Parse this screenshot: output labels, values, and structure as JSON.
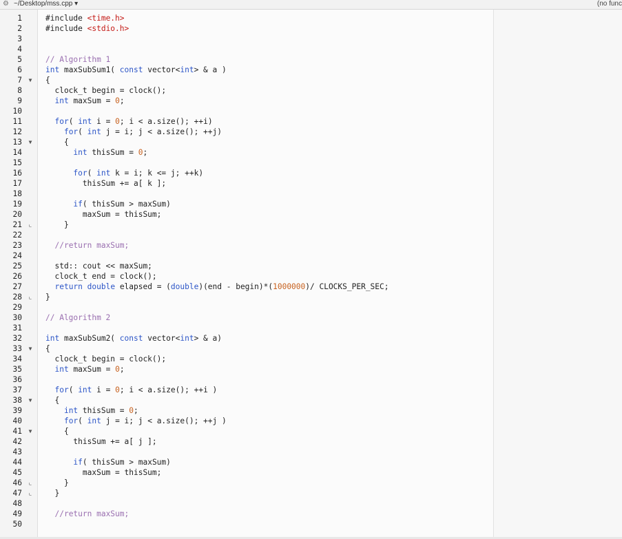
{
  "titlebar": {
    "path": "~/Desktop/mss.cpp",
    "function_menu": "(no func",
    "gear_icon": "gear-icon"
  },
  "lines": [
    {
      "n": "1",
      "fold": "",
      "tokens": [
        [
          "pp",
          "#include "
        ],
        [
          "str",
          "<time.h>"
        ]
      ]
    },
    {
      "n": "2",
      "fold": "",
      "tokens": [
        [
          "pp",
          "#include "
        ],
        [
          "str",
          "<stdio.h>"
        ]
      ]
    },
    {
      "n": "3",
      "fold": "",
      "tokens": []
    },
    {
      "n": "4",
      "fold": "",
      "tokens": []
    },
    {
      "n": "5",
      "fold": "",
      "tokens": [
        [
          "cm",
          "// Algorithm 1"
        ]
      ]
    },
    {
      "n": "6",
      "fold": "",
      "tokens": [
        [
          "kw",
          "int"
        ],
        [
          "t",
          " maxSubSum1( "
        ],
        [
          "kw",
          "const"
        ],
        [
          "t",
          " vector<"
        ],
        [
          "kw",
          "int"
        ],
        [
          "t",
          "> & a )"
        ]
      ]
    },
    {
      "n": "7",
      "fold": "open",
      "tokens": [
        [
          "t",
          "{"
        ]
      ]
    },
    {
      "n": "8",
      "fold": "",
      "tokens": [
        [
          "t",
          "  clock_t begin = clock();"
        ]
      ]
    },
    {
      "n": "9",
      "fold": "",
      "tokens": [
        [
          "t",
          "  "
        ],
        [
          "kw",
          "int"
        ],
        [
          "t",
          " maxSum = "
        ],
        [
          "num",
          "0"
        ],
        [
          "t",
          ";"
        ]
      ]
    },
    {
      "n": "10",
      "fold": "",
      "tokens": []
    },
    {
      "n": "11",
      "fold": "",
      "tokens": [
        [
          "t",
          "  "
        ],
        [
          "kw",
          "for"
        ],
        [
          "t",
          "( "
        ],
        [
          "kw",
          "int"
        ],
        [
          "t",
          " i = "
        ],
        [
          "num",
          "0"
        ],
        [
          "t",
          "; i < a.size(); ++i)"
        ]
      ]
    },
    {
      "n": "12",
      "fold": "",
      "tokens": [
        [
          "t",
          "    "
        ],
        [
          "kw",
          "for"
        ],
        [
          "t",
          "( "
        ],
        [
          "kw",
          "int"
        ],
        [
          "t",
          " j = i; j < a.size(); ++j)"
        ]
      ]
    },
    {
      "n": "13",
      "fold": "open",
      "tokens": [
        [
          "t",
          "    {"
        ]
      ]
    },
    {
      "n": "14",
      "fold": "",
      "tokens": [
        [
          "t",
          "      "
        ],
        [
          "kw",
          "int"
        ],
        [
          "t",
          " thisSum = "
        ],
        [
          "num",
          "0"
        ],
        [
          "t",
          ";"
        ]
      ]
    },
    {
      "n": "15",
      "fold": "",
      "tokens": []
    },
    {
      "n": "16",
      "fold": "",
      "tokens": [
        [
          "t",
          "      "
        ],
        [
          "kw",
          "for"
        ],
        [
          "t",
          "( "
        ],
        [
          "kw",
          "int"
        ],
        [
          "t",
          " k = i; k <= j; ++k)"
        ]
      ]
    },
    {
      "n": "17",
      "fold": "",
      "tokens": [
        [
          "t",
          "        thisSum += a[ k ];"
        ]
      ]
    },
    {
      "n": "18",
      "fold": "",
      "tokens": []
    },
    {
      "n": "19",
      "fold": "",
      "tokens": [
        [
          "t",
          "      "
        ],
        [
          "kw",
          "if"
        ],
        [
          "t",
          "( thisSum > maxSum)"
        ]
      ]
    },
    {
      "n": "20",
      "fold": "",
      "tokens": [
        [
          "t",
          "        maxSum = thisSum;"
        ]
      ]
    },
    {
      "n": "21",
      "fold": "close",
      "tokens": [
        [
          "t",
          "    }"
        ]
      ]
    },
    {
      "n": "22",
      "fold": "",
      "tokens": []
    },
    {
      "n": "23",
      "fold": "",
      "tokens": [
        [
          "t",
          "  "
        ],
        [
          "cm",
          "//return maxSum;"
        ]
      ]
    },
    {
      "n": "24",
      "fold": "",
      "tokens": []
    },
    {
      "n": "25",
      "fold": "",
      "tokens": [
        [
          "t",
          "  std:: cout << maxSum;"
        ]
      ]
    },
    {
      "n": "26",
      "fold": "",
      "tokens": [
        [
          "t",
          "  clock_t end = clock();"
        ]
      ]
    },
    {
      "n": "27",
      "fold": "",
      "tokens": [
        [
          "t",
          "  "
        ],
        [
          "kw",
          "return"
        ],
        [
          "t",
          " "
        ],
        [
          "kw",
          "double"
        ],
        [
          "t",
          " elapsed = ("
        ],
        [
          "kw",
          "double"
        ],
        [
          "t",
          ")(end - begin)*("
        ],
        [
          "num",
          "1000000"
        ],
        [
          "t",
          ")/ CLOCKS_PER_SEC;"
        ]
      ]
    },
    {
      "n": "28",
      "fold": "close",
      "tokens": [
        [
          "t",
          "}"
        ]
      ]
    },
    {
      "n": "29",
      "fold": "",
      "tokens": []
    },
    {
      "n": "30",
      "fold": "",
      "tokens": [
        [
          "cm",
          "// Algorithm 2"
        ]
      ]
    },
    {
      "n": "31",
      "fold": "",
      "tokens": []
    },
    {
      "n": "32",
      "fold": "",
      "tokens": [
        [
          "kw",
          "int"
        ],
        [
          "t",
          " maxSubSum2( "
        ],
        [
          "kw",
          "const"
        ],
        [
          "t",
          " vector<"
        ],
        [
          "kw",
          "int"
        ],
        [
          "t",
          "> & a)"
        ]
      ]
    },
    {
      "n": "33",
      "fold": "open",
      "tokens": [
        [
          "t",
          "{"
        ]
      ]
    },
    {
      "n": "34",
      "fold": "",
      "tokens": [
        [
          "t",
          "  clock_t begin = clock();"
        ]
      ]
    },
    {
      "n": "35",
      "fold": "",
      "tokens": [
        [
          "t",
          "  "
        ],
        [
          "kw",
          "int"
        ],
        [
          "t",
          " maxSum = "
        ],
        [
          "num",
          "0"
        ],
        [
          "t",
          ";"
        ]
      ]
    },
    {
      "n": "36",
      "fold": "",
      "tokens": []
    },
    {
      "n": "37",
      "fold": "",
      "tokens": [
        [
          "t",
          "  "
        ],
        [
          "kw",
          "for"
        ],
        [
          "t",
          "( "
        ],
        [
          "kw",
          "int"
        ],
        [
          "t",
          " i = "
        ],
        [
          "num",
          "0"
        ],
        [
          "t",
          "; i < a.size(); ++i )"
        ]
      ]
    },
    {
      "n": "38",
      "fold": "open",
      "tokens": [
        [
          "t",
          "  {"
        ]
      ]
    },
    {
      "n": "39",
      "fold": "",
      "tokens": [
        [
          "t",
          "    "
        ],
        [
          "kw",
          "int"
        ],
        [
          "t",
          " thisSum = "
        ],
        [
          "num",
          "0"
        ],
        [
          "t",
          ";"
        ]
      ]
    },
    {
      "n": "40",
      "fold": "",
      "tokens": [
        [
          "t",
          "    "
        ],
        [
          "kw",
          "for"
        ],
        [
          "t",
          "( "
        ],
        [
          "kw",
          "int"
        ],
        [
          "t",
          " j = i; j < a.size(); ++j )"
        ]
      ]
    },
    {
      "n": "41",
      "fold": "open",
      "tokens": [
        [
          "t",
          "    {"
        ]
      ]
    },
    {
      "n": "42",
      "fold": "",
      "tokens": [
        [
          "t",
          "      thisSum += a[ j ];"
        ]
      ]
    },
    {
      "n": "43",
      "fold": "",
      "tokens": []
    },
    {
      "n": "44",
      "fold": "",
      "tokens": [
        [
          "t",
          "      "
        ],
        [
          "kw",
          "if"
        ],
        [
          "t",
          "( thisSum > maxSum)"
        ]
      ]
    },
    {
      "n": "45",
      "fold": "",
      "tokens": [
        [
          "t",
          "        maxSum = thisSum;"
        ]
      ]
    },
    {
      "n": "46",
      "fold": "close",
      "tokens": [
        [
          "t",
          "    }"
        ]
      ]
    },
    {
      "n": "47",
      "fold": "close",
      "tokens": [
        [
          "t",
          "  }"
        ]
      ]
    },
    {
      "n": "48",
      "fold": "",
      "tokens": []
    },
    {
      "n": "49",
      "fold": "",
      "tokens": [
        [
          "t",
          "  "
        ],
        [
          "cm",
          "//return maxSum;"
        ]
      ]
    },
    {
      "n": "50",
      "fold": "",
      "tokens": []
    }
  ],
  "colors": {
    "keyword": "#2c55c7",
    "string": "#c41a16",
    "number": "#c7601d",
    "comment": "#9a6fb0"
  }
}
